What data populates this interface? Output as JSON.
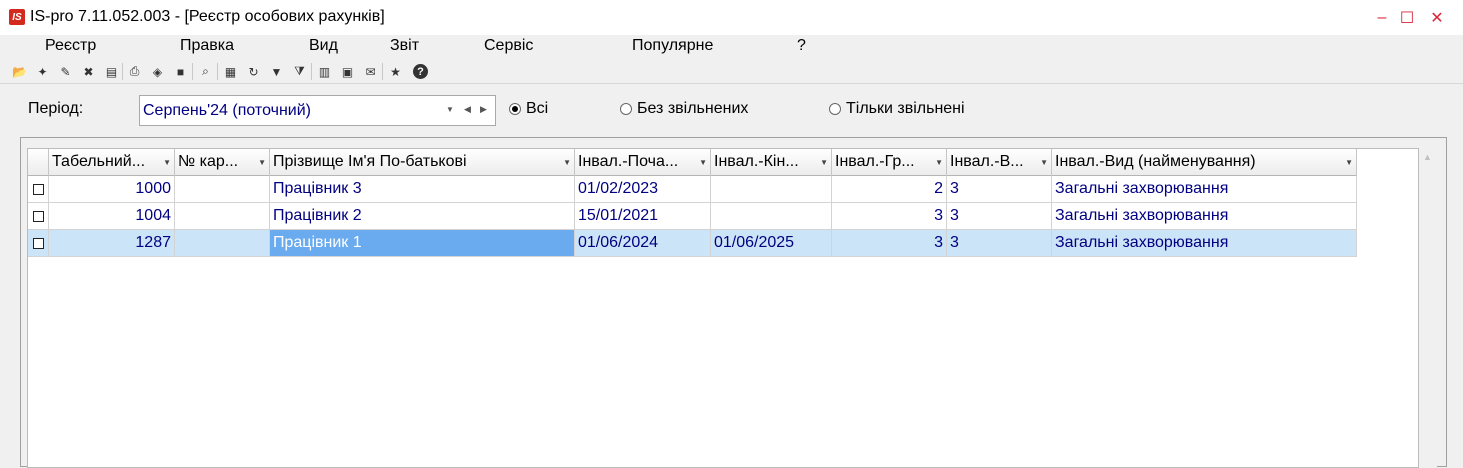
{
  "window": {
    "logo_text": "IS",
    "title": "IS-pro 7.11.052.003 - [Реєстр особових рахунків]",
    "controls": {
      "minimize": "–",
      "maximize": "☐",
      "close": "✕"
    }
  },
  "menu": {
    "items": [
      "Реєстр",
      "Правка",
      "Вид",
      "Звіт",
      "Сервіс",
      "Популярне",
      "?"
    ]
  },
  "toolbar": {
    "icons": [
      {
        "name": "open-icon",
        "glyph": "📂"
      },
      {
        "name": "new-record-icon",
        "glyph": "✦"
      },
      {
        "name": "edit-record-icon",
        "glyph": "✎"
      },
      {
        "name": "delete-record-icon",
        "glyph": "✖"
      },
      {
        "name": "calculator-icon",
        "glyph": "▤"
      },
      {
        "name": "print-icon",
        "glyph": "⎙"
      },
      {
        "name": "package-icon",
        "glyph": "◈"
      },
      {
        "name": "archive-icon",
        "glyph": "■"
      },
      {
        "name": "search-icon",
        "glyph": "⌕"
      },
      {
        "name": "grid-icon",
        "glyph": "▦"
      },
      {
        "name": "refresh-icon",
        "glyph": "↻"
      },
      {
        "name": "filter-icon",
        "glyph": "▼"
      },
      {
        "name": "filter-settings-icon",
        "glyph": "⧩"
      },
      {
        "name": "chart-icon",
        "glyph": "▥"
      },
      {
        "name": "document-icon",
        "glyph": "▣"
      },
      {
        "name": "mail-icon",
        "glyph": "✉"
      },
      {
        "name": "favorite-icon",
        "glyph": "★"
      },
      {
        "name": "help-icon",
        "glyph": "?"
      }
    ]
  },
  "filter": {
    "period_label": "Період:",
    "period_value": "Серпень'24 (поточний)",
    "period_controls": {
      "dropdown": "▼",
      "prev": "◀",
      "next": "▶"
    },
    "radios": [
      {
        "label": "Всі",
        "checked": true
      },
      {
        "label": "Без звільнених",
        "checked": false
      },
      {
        "label": "Тільки звільнені",
        "checked": false
      }
    ]
  },
  "grid": {
    "columns": [
      "Табельний...",
      "№ кар...",
      "Прізвище Ім'я По-батькові",
      "Інвал.-Поча...",
      "Інвал.-Кін...",
      "Інвал.-Гр...",
      "Інвал.-В...",
      "Інвал.-Вид (найменування)"
    ],
    "rows": [
      {
        "tab": "1000",
        "card": "",
        "name": "Працівник 3",
        "start": "01/02/2023",
        "end": "",
        "group": "2",
        "v": "3",
        "kind": "Загальні захворювання",
        "selected": false
      },
      {
        "tab": "1004",
        "card": "",
        "name": "Працівник 2",
        "start": "15/01/2021",
        "end": "",
        "group": "3",
        "v": "3",
        "kind": "Загальні захворювання",
        "selected": false
      },
      {
        "tab": "1287",
        "card": "",
        "name": "Працівник 1",
        "start": "01/06/2024",
        "end": "01/06/2025",
        "group": "3",
        "v": "3",
        "kind": "Загальні захворювання",
        "selected": true
      }
    ]
  }
}
